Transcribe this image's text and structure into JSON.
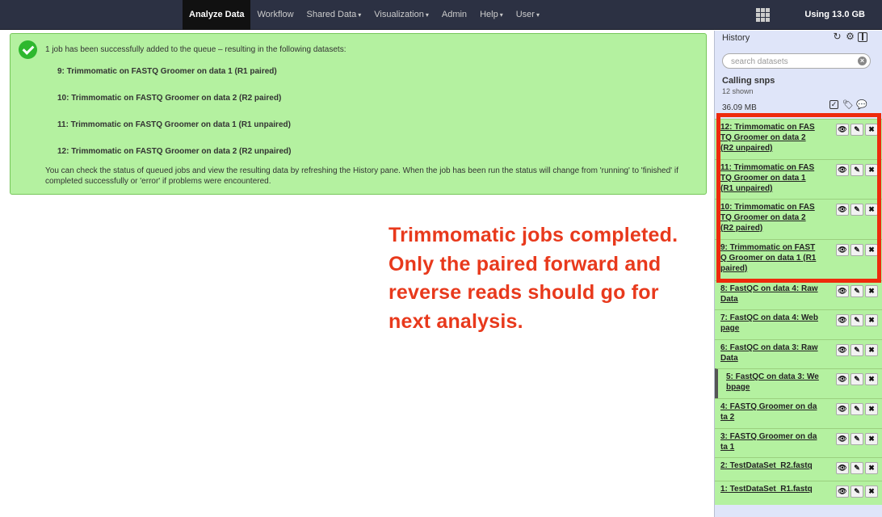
{
  "topbar": {
    "nav": [
      {
        "label": "Analyze Data",
        "active": true,
        "caret": false
      },
      {
        "label": "Workflow",
        "active": false,
        "caret": false
      },
      {
        "label": "Shared Data",
        "active": false,
        "caret": true
      },
      {
        "label": "Visualization",
        "active": false,
        "caret": true
      },
      {
        "label": "Admin",
        "active": false,
        "caret": false
      },
      {
        "label": "Help",
        "active": false,
        "caret": true
      },
      {
        "label": "User",
        "active": false,
        "caret": true
      }
    ],
    "quota": "Using 13.0 GB"
  },
  "message": {
    "intro": "1 job has been successfully added to the queue – resulting in the following datasets:",
    "datasets": [
      "9: Trimmomatic on FASTQ Groomer on data 1 (R1 paired)",
      "10: Trimmomatic on FASTQ Groomer on data 2 (R2 paired)",
      "11: Trimmomatic on FASTQ Groomer on data 1 (R1 unpaired)",
      "12: Trimmomatic on FASTQ Groomer on data 2 (R2 unpaired)"
    ],
    "note": "You can check the status of queued jobs and view the resulting data by refreshing the History pane. When the job has been run the status will change from 'running' to 'finished' if completed successfully or 'error' if problems were encountered."
  },
  "annotation": {
    "lines": [
      "Trimmomatic jobs completed.",
      "Only the paired forward and",
      "reverse reads should go for",
      "next analysis."
    ],
    "color": "#e8391c"
  },
  "history": {
    "title": "History",
    "search_placeholder": "search datasets",
    "name": "Calling snps",
    "shown": "12 shown",
    "size": "36.09 MB",
    "icons": [
      "refresh-icon",
      "gear-icon",
      "columns-icon"
    ],
    "datasets": [
      {
        "lines": [
          "12: Trimmomatic on FAS",
          "TQ Groomer on data 2",
          "(R2 unpaired)"
        ]
      },
      {
        "lines": [
          "11: Trimmomatic on FAS",
          "TQ Groomer on data 1",
          "(R1 unpaired)"
        ]
      },
      {
        "lines": [
          "10: Trimmomatic on FAS",
          "TQ Groomer on data 2",
          "(R2 paired)"
        ]
      },
      {
        "lines": [
          "9: Trimmomatic on FAST",
          "Q Groomer on data 1 (R1",
          "paired)"
        ]
      },
      {
        "lines": [
          "8: FastQC on data 4: Raw",
          "Data"
        ]
      },
      {
        "lines": [
          "7: FastQC on data 4: Web",
          "page"
        ]
      },
      {
        "lines": [
          "6: FastQC on data 3: Raw",
          "Data"
        ]
      },
      {
        "lines": [
          "5: FastQC on data 3: We",
          "bpage"
        ],
        "selected": true
      },
      {
        "lines": [
          "4: FASTQ Groomer on da",
          "ta 2"
        ]
      },
      {
        "lines": [
          "3: FASTQ Groomer on da",
          "ta 1"
        ]
      },
      {
        "lines": [
          "2: TestDataSet_R2.fastq"
        ]
      },
      {
        "lines": [
          "1: TestDataSet_R1.fastq"
        ]
      }
    ],
    "ok_color": "#b4f1a0"
  }
}
